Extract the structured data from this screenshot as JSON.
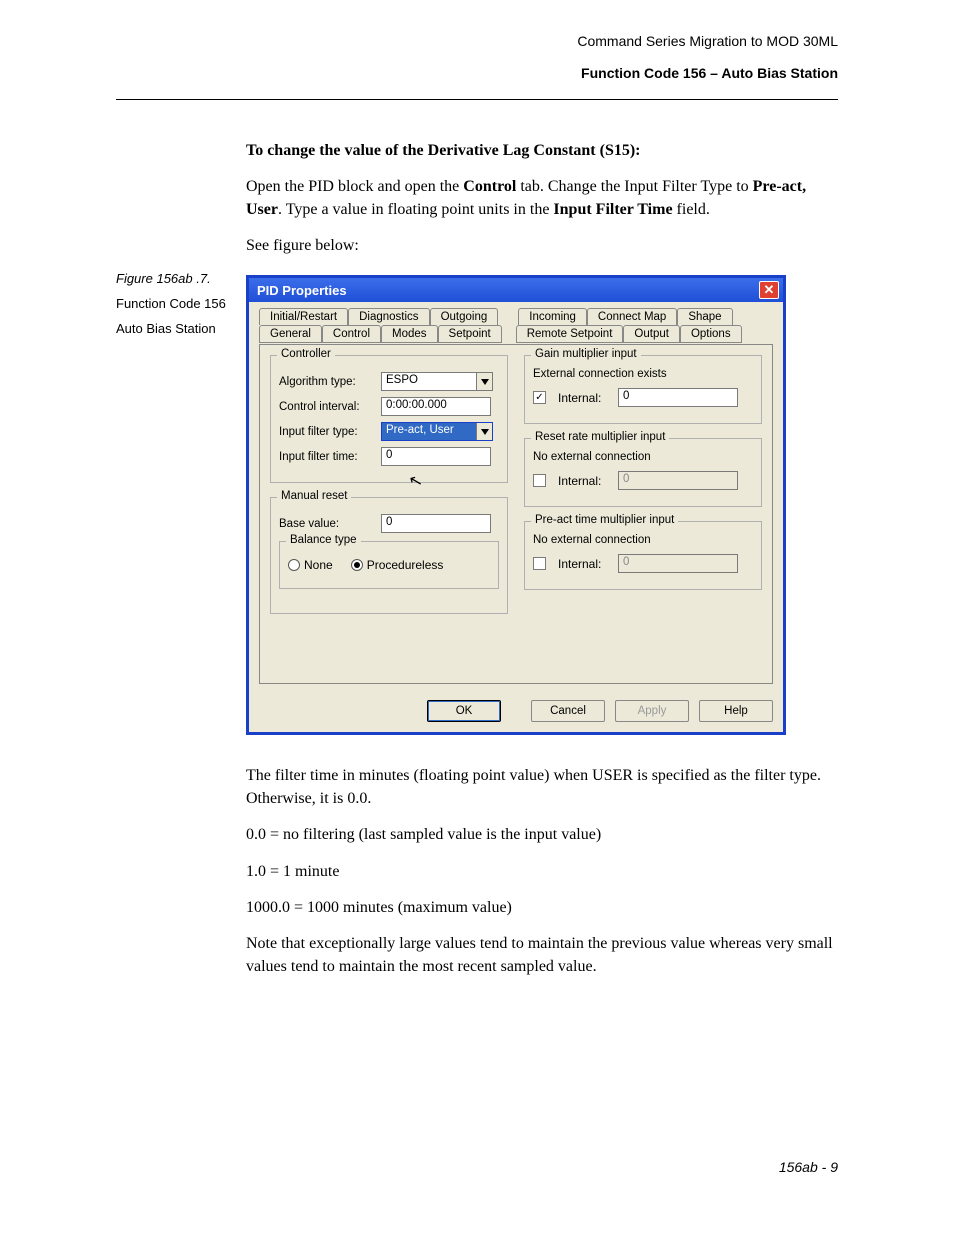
{
  "header": {
    "line1": "Command Series Migration to MOD 30ML",
    "line2": "Function Code 156 – Auto Bias Station"
  },
  "sidebar": {
    "fig_caption": "Figure 156ab .7.",
    "fig_t1": "Function Code 156",
    "fig_t2": "Auto Bias Station"
  },
  "prose": {
    "lead": "To change the value of the Derivative Lag Constant (S15):",
    "p1a": "Open the PID block and open the ",
    "p1b": "Control",
    "p1c": " tab. Change the Input Filter Type to ",
    "p1d": "Pre-act, User",
    "p1e": ". Type a value in floating point units in the ",
    "p1f": "Input Filter Time",
    "p1g": " field.",
    "p2": "See figure below:",
    "after1": "The filter time in minutes (floating point value) when USER is specified as the filter type. Otherwise, it is 0.0.",
    "after2": "0.0 = no filtering (last sampled value is the input value)",
    "after3": "1.0 = 1 minute",
    "after4": "1000.0 = 1000 minutes (maximum value)",
    "after5": "Note that exceptionally large values tend to maintain the previous value whereas very small values tend to maintain the most recent sampled value."
  },
  "dialog": {
    "title": "PID Properties",
    "tabs_row1": [
      "Initial/Restart",
      "Diagnostics",
      "Outgoing",
      "Incoming",
      "Connect Map",
      "Shape"
    ],
    "tabs_row2": [
      "General",
      "Control",
      "Modes",
      "Setpoint",
      "Remote Setpoint",
      "Output",
      "Options"
    ],
    "active_tab": "Control",
    "controller": {
      "legend": "Controller",
      "algo_label": "Algorithm type:",
      "algo_value": "ESPO",
      "interval_label": "Control interval:",
      "interval_value": "0:00:00.000",
      "filter_type_label": "Input filter type:",
      "filter_type_value": "Pre-act, User",
      "filter_time_label": "Input filter time:",
      "filter_time_value": "0"
    },
    "manual_reset": {
      "legend": "Manual reset",
      "base_label": "Base value:",
      "base_value": "0",
      "balance_legend": "Balance type",
      "none": "None",
      "proc": "Procedureless"
    },
    "gain": {
      "legend": "Gain multiplier input",
      "conn": "External connection exists",
      "internal_label": "Internal:",
      "internal_value": "0",
      "checked": true
    },
    "reset": {
      "legend": "Reset rate multiplier input",
      "conn": "No external connection",
      "internal_label": "Internal:",
      "internal_value": "0",
      "checked": false
    },
    "preact": {
      "legend": "Pre-act time multiplier input",
      "conn": "No external connection",
      "internal_label": "Internal:",
      "internal_value": "0",
      "checked": false
    },
    "buttons": {
      "ok": "OK",
      "cancel": "Cancel",
      "apply": "Apply",
      "help": "Help"
    }
  },
  "page_number": "156ab - 9"
}
